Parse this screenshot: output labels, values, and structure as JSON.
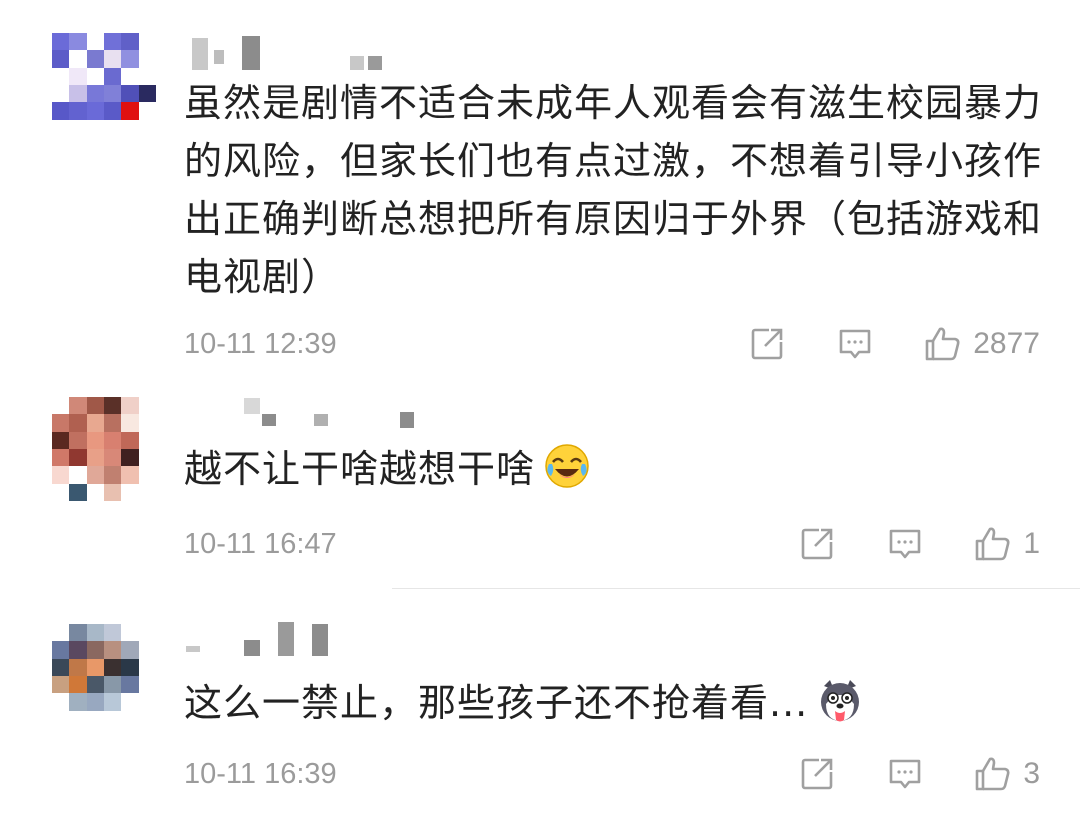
{
  "comments": [
    {
      "text": "虽然是剧情不适合未成年人观看会有滋生校园暴力的风险，但家长们也有点过激，不想着引导小孩作出正确判断总想把所有原因归于外界（包括游戏和电视剧）",
      "time": "10-11 12:39",
      "likes": "2877",
      "avatar_colors": [
        "#6b6bd8",
        "#8a8ae0",
        "#ffffff",
        "#7070d8",
        "#6060c8",
        "#ffffff",
        "#5c5cc8",
        "#ffffff",
        "#7a7ad0",
        "#e8e0f0",
        "#9090e0",
        "#ffffff",
        "#ffffff",
        "#f0e8f8",
        "#ffffff",
        "#6a6ad0",
        "#ffffff",
        "#ffffff",
        "#ffffff",
        "#c8c0e8",
        "#7878d8",
        "#8080d8",
        "#5050b8",
        "#2a2a60",
        "#5858c8",
        "#6262d0",
        "#6a6ad8",
        "#5a5ac8",
        "#e01010",
        "#ffffff",
        "#ffffff",
        "#ffffff",
        "#ffffff",
        "#ffffff",
        "#ffffff",
        "#ffffff"
      ]
    },
    {
      "text": "越不让干啥越想干啥",
      "emoji": "laughing-crying-emoji",
      "time": "10-11 16:47",
      "likes": "1",
      "avatar_colors": [
        "#ffffff",
        "#d08878",
        "#a05848",
        "#5a3028",
        "#f0d0c8",
        "#ffffff",
        "#c87868",
        "#b06050",
        "#e8a890",
        "#b87060",
        "#f8e8e0",
        "#ffffff",
        "#5a2820",
        "#c07060",
        "#e89880",
        "#d88070",
        "#c06858",
        "#ffffff",
        "#d07868",
        "#903830",
        "#e8a088",
        "#d88878",
        "#402020",
        "#ffffff",
        "#f8d8d0",
        "#ffffff",
        "#e0a898",
        "#c08070",
        "#f0c0b0",
        "#ffffff",
        "#ffffff",
        "#3a5870",
        "#ffffff",
        "#e8c0b0",
        "#ffffff",
        "#ffffff"
      ]
    },
    {
      "text": "这么一禁止，那些孩子还不抢着看...",
      "emoji": "husky-tongue-emoji",
      "time": "10-11 16:39",
      "likes": "3",
      "avatar_colors": [
        "#ffffff",
        "#7888a0",
        "#a8b8c8",
        "#c0c8d8",
        "#ffffff",
        "#ffffff",
        "#6878a0",
        "#5a4860",
        "#8a6860",
        "#b89080",
        "#a0a8b8",
        "#ffffff",
        "#3a4858",
        "#c07848",
        "#e89868",
        "#3a3030",
        "#2a3848",
        "#ffffff",
        "#c8a080",
        "#d07838",
        "#4a5868",
        "#8898a8",
        "#6878a0",
        "#ffffff",
        "#ffffff",
        "#a0b0c0",
        "#98a8c0",
        "#b8c8d8",
        "#ffffff",
        "#ffffff",
        "#ffffff",
        "#ffffff",
        "#ffffff",
        "#ffffff",
        "#ffffff",
        "#ffffff"
      ]
    }
  ],
  "colors": {
    "meta": "#9b9b9b",
    "text": "#222222",
    "icon": "#a0a0a0"
  },
  "icons": [
    "share-icon",
    "reply-comment-icon",
    "like-thumb-icon"
  ]
}
